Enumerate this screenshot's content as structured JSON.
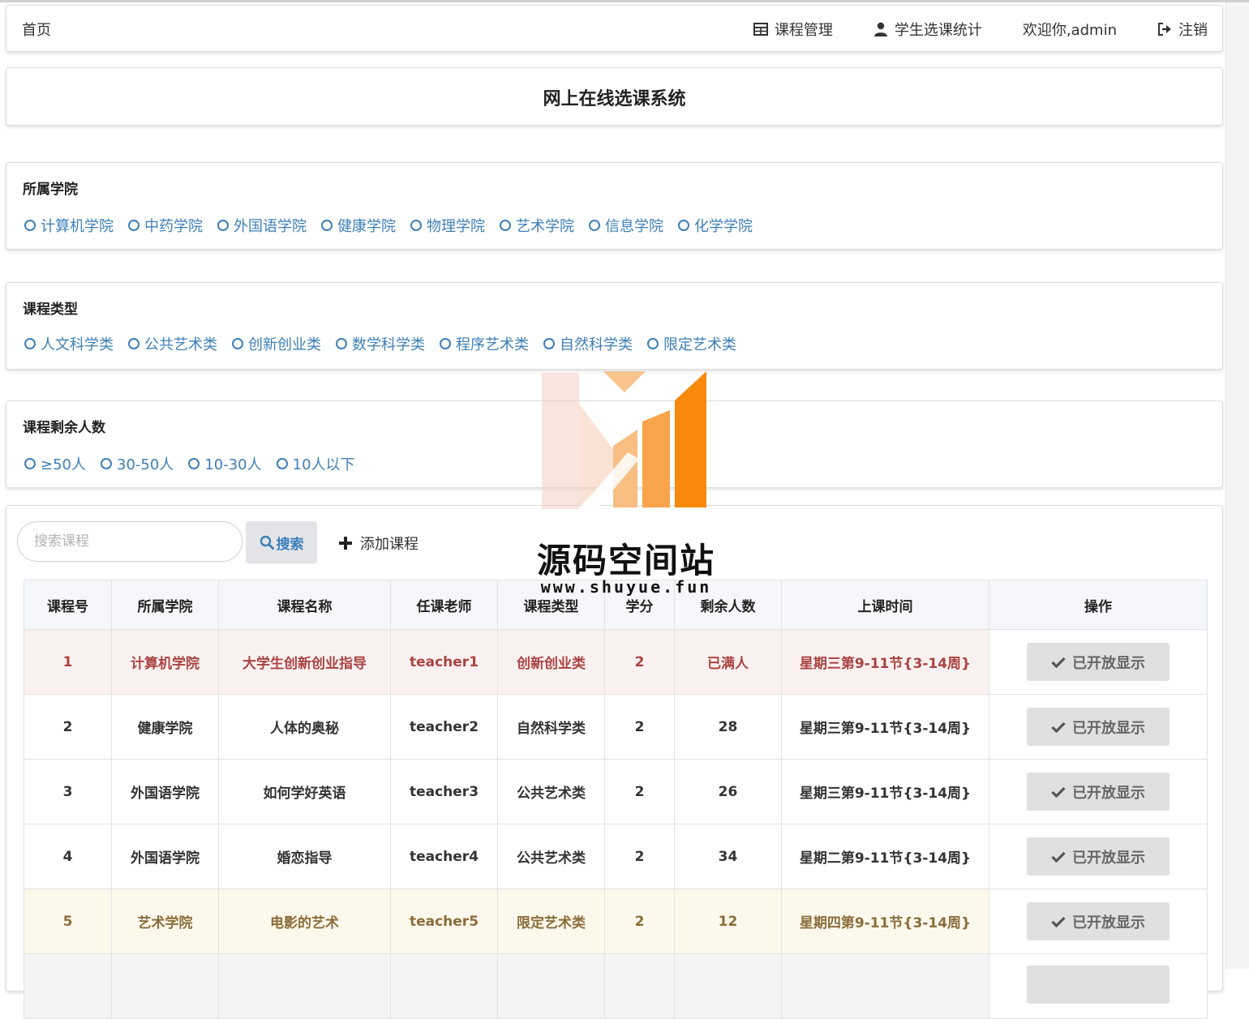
{
  "navbar": {
    "home": "首页",
    "course_manage": "课程管理",
    "student_stats": "学生选课统计",
    "welcome": "欢迎你,admin",
    "logout": "注销"
  },
  "title": "网上在线选课系统",
  "filters": {
    "college": {
      "title": "所属学院",
      "options": [
        "计算机学院",
        "中药学院",
        "外国语学院",
        "健康学院",
        "物理学院",
        "艺术学院",
        "信息学院",
        "化学学院"
      ]
    },
    "course_type": {
      "title": "课程类型",
      "options": [
        "人文科学类",
        "公共艺术类",
        "创新创业类",
        "数学科学类",
        "程序艺术类",
        "自然科学类",
        "限定艺术类"
      ]
    },
    "remaining": {
      "title": "课程剩余人数",
      "options": [
        "≥50人",
        "30-50人",
        "10-30人",
        "10人以下"
      ]
    }
  },
  "toolbar": {
    "search_placeholder": "搜索课程",
    "search_label": "搜索",
    "add_label": "添加课程"
  },
  "table": {
    "headers": [
      "课程号",
      "所属学院",
      "课程名称",
      "任课老师",
      "课程类型",
      "学分",
      "剩余人数",
      "上课时间",
      "操作"
    ],
    "rows": [
      {
        "id": "1",
        "college": "计算机学院",
        "name": "大学生创新创业指导",
        "teacher": "teacher1",
        "type": "创新创业类",
        "credit": "2",
        "remaining": "已满人",
        "time": "星期三第9-11节{3-14周}",
        "action": "已开放显示"
      },
      {
        "id": "2",
        "college": "健康学院",
        "name": "人体的奥秘",
        "teacher": "teacher2",
        "type": "自然科学类",
        "credit": "2",
        "remaining": "28",
        "time": "星期三第9-11节{3-14周}",
        "action": "已开放显示"
      },
      {
        "id": "3",
        "college": "外国语学院",
        "name": "如何学好英语",
        "teacher": "teacher3",
        "type": "公共艺术类",
        "credit": "2",
        "remaining": "26",
        "time": "星期三第9-11节{3-14周}",
        "action": "已开放显示"
      },
      {
        "id": "4",
        "college": "外国语学院",
        "name": "婚恋指导",
        "teacher": "teacher4",
        "type": "公共艺术类",
        "credit": "2",
        "remaining": "34",
        "time": "星期二第9-11节{3-14周}",
        "action": "已开放显示"
      },
      {
        "id": "5",
        "college": "艺术学院",
        "name": "电影的艺术",
        "teacher": "teacher5",
        "type": "限定艺术类",
        "credit": "2",
        "remaining": "12",
        "time": "星期四第9-11节{3-14周}",
        "action": "已开放显示"
      }
    ]
  },
  "watermark": {
    "name": "源码空间站",
    "url": "www.shuyue.fun"
  },
  "colors": {
    "link_blue": "#3d7fb8",
    "danger_text": "#a94442",
    "warning_text": "#8a6d3b",
    "watermark_orange": "#f7890c"
  }
}
